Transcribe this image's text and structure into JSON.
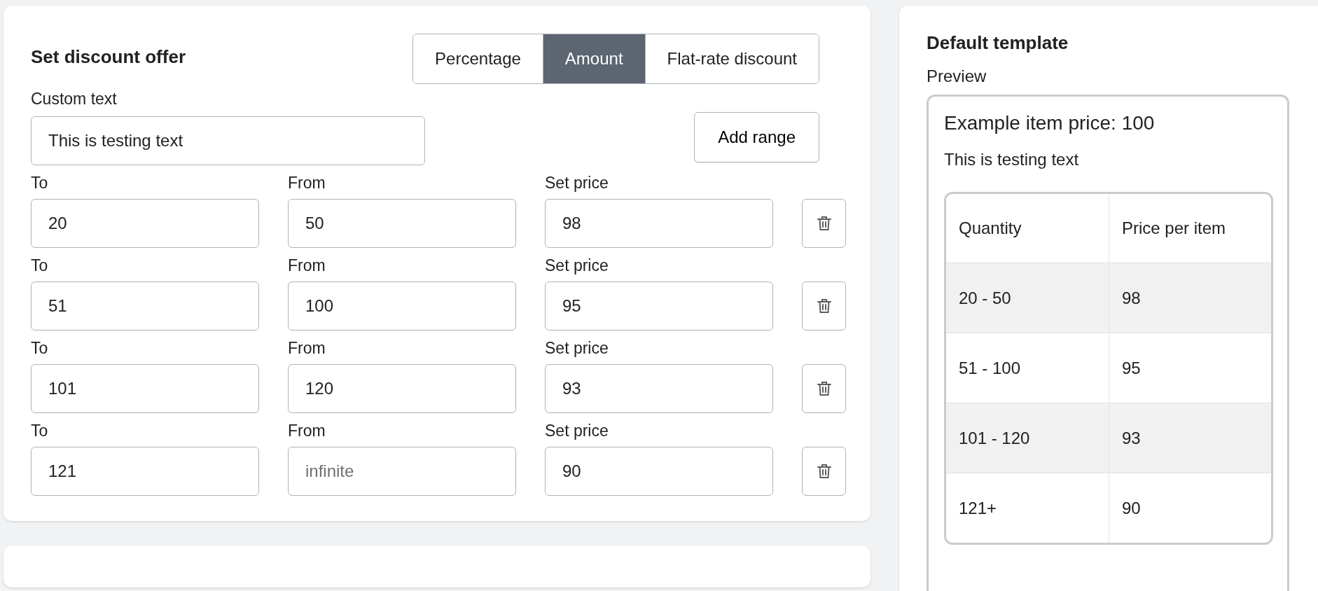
{
  "discount_offer": {
    "title": "Set discount offer",
    "modes": [
      {
        "label": "Percentage",
        "selected": false
      },
      {
        "label": "Amount",
        "selected": true
      },
      {
        "label": "Flat-rate discount",
        "selected": false
      }
    ],
    "custom_text": {
      "label": "Custom text",
      "value": "This is testing text"
    },
    "add_range_button": "Add range",
    "ranges": [
      {
        "to_label": "To",
        "to": "20",
        "from_label": "From",
        "from": {
          "value": "50"
        },
        "price_label": "Set price",
        "price": "98"
      },
      {
        "to_label": "To",
        "to": "51",
        "from_label": "From",
        "from": {
          "value": "100"
        },
        "price_label": "Set price",
        "price": "95"
      },
      {
        "to_label": "To",
        "to": "101",
        "from_label": "From",
        "from": {
          "value": "120"
        },
        "price_label": "Set price",
        "price": "93"
      },
      {
        "to_label": "To",
        "to": "121",
        "from_label": "From",
        "from": {
          "placeholder": "infinite"
        },
        "price_label": "Set price",
        "price": "90"
      }
    ]
  },
  "template": {
    "title": "Default template",
    "preview_label": "Preview",
    "example_price": "Example item price: 100",
    "custom_text": "This is testing text",
    "table": {
      "columns": [
        "Quantity",
        "Price per item"
      ],
      "rows": [
        [
          "20 - 50",
          "98"
        ],
        [
          "51 - 100",
          "95"
        ],
        [
          "101 - 120",
          "93"
        ],
        [
          "121+",
          "90"
        ]
      ]
    }
  }
}
